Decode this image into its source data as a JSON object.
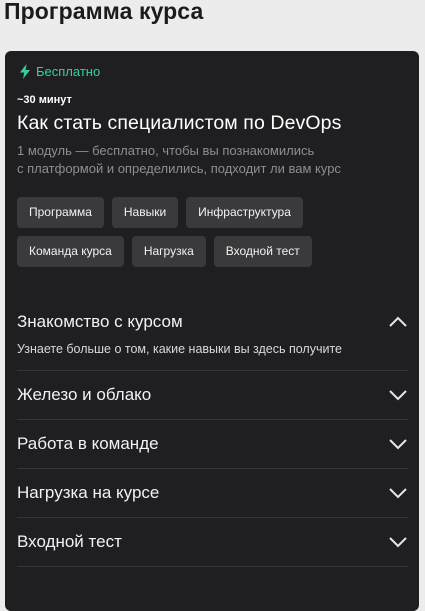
{
  "page": {
    "title": "Программа курса"
  },
  "card": {
    "badge": {
      "label": "Бесплатно",
      "icon": "lightning-icon",
      "color": "#36d19b"
    },
    "duration": "~30 минут",
    "title": "Как стать специалистом по DevOps",
    "description_line1": "1 модуль — бесплатно, чтобы вы познакомились",
    "description_line2": "с платформой и определились, подходит ли вам курс"
  },
  "chips": [
    {
      "label": "Программа"
    },
    {
      "label": "Навыки"
    },
    {
      "label": "Инфраструктура"
    },
    {
      "label": "Команда курса"
    },
    {
      "label": "Нагрузка"
    },
    {
      "label": "Входной тест"
    }
  ],
  "accordion": [
    {
      "title": "Знакомство с курсом",
      "expanded": true,
      "body": "Узнаете больше о том, какие навыки вы здесь получите",
      "icon": "chevron-up-icon"
    },
    {
      "title": "Железо и облако",
      "expanded": false,
      "icon": "chevron-down-icon"
    },
    {
      "title": "Работа в команде",
      "expanded": false,
      "icon": "chevron-down-icon"
    },
    {
      "title": "Нагрузка на курсе",
      "expanded": false,
      "icon": "chevron-down-icon"
    },
    {
      "title": "Входной тест",
      "expanded": false,
      "icon": "chevron-down-icon"
    }
  ],
  "colors": {
    "card_bg": "#1f1f21",
    "chip_bg": "#3a3a3c",
    "accent_green": "#36d19b"
  }
}
